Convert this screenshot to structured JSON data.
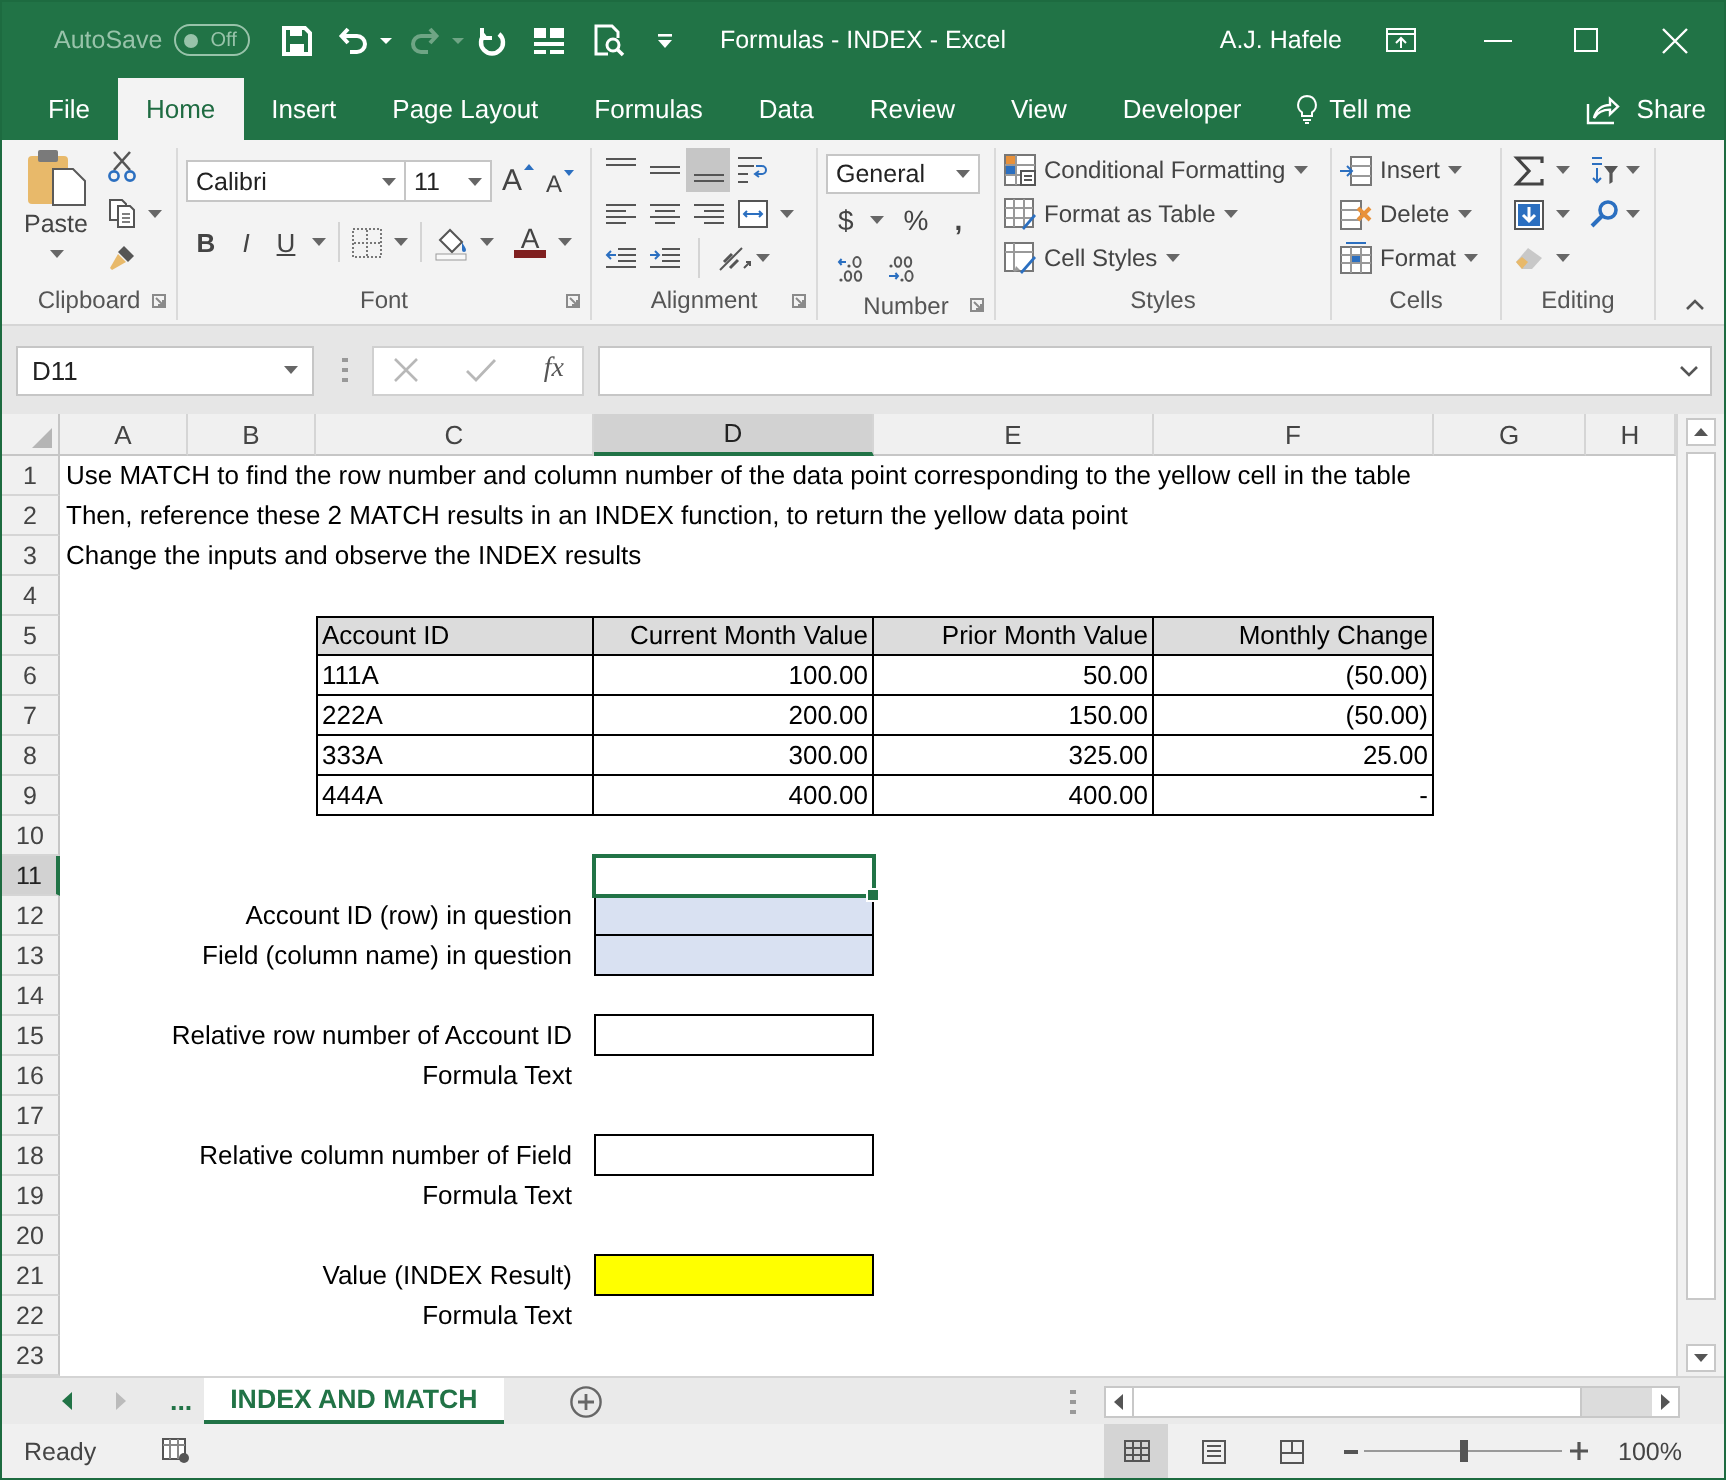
{
  "window": {
    "title": "Formulas - INDEX - Excel",
    "user": "A.J. Hafele"
  },
  "quick_access": {
    "autosave_label": "AutoSave",
    "autosave_state": "Off",
    "autosave_on": false,
    "tools": [
      {
        "kind": "save",
        "disabled": false
      },
      {
        "kind": "undo",
        "disabled": false
      },
      {
        "kind": "redo",
        "disabled": true
      },
      {
        "kind": "refresh",
        "disabled": false
      },
      {
        "kind": "layout",
        "disabled": false
      },
      {
        "kind": "preview",
        "disabled": false
      },
      {
        "kind": "customize",
        "disabled": false
      }
    ]
  },
  "ribbon_tabs": [
    {
      "label": "File",
      "selected": false
    },
    {
      "label": "Home",
      "selected": true
    },
    {
      "label": "Insert",
      "selected": false
    },
    {
      "label": "Page Layout",
      "selected": false
    },
    {
      "label": "Formulas",
      "selected": false
    },
    {
      "label": "Data",
      "selected": false
    },
    {
      "label": "Review",
      "selected": false
    },
    {
      "label": "View",
      "selected": false
    },
    {
      "label": "Developer",
      "selected": false
    }
  ],
  "tell_me": "Tell me",
  "share": "Share",
  "ribbon": {
    "clipboard": {
      "paste": "Paste",
      "label": "Clipboard"
    },
    "font": {
      "font_name": "Calibri",
      "font_size": "11",
      "grow": "A",
      "shrink": "A",
      "bold": "B",
      "italic": "I",
      "underline": "U",
      "font_color": "A",
      "label": "Font"
    },
    "alignment": {
      "vertical": [
        {
          "kind": "top",
          "selected": false
        },
        {
          "kind": "middle",
          "selected": false
        },
        {
          "kind": "bottom",
          "selected": true
        }
      ],
      "label": "Alignment"
    },
    "number": {
      "format": "General",
      "currency": "$",
      "percent": "%",
      "comma": ",",
      "label": "Number"
    },
    "styles": {
      "buttons": [
        {
          "kind": "conditional",
          "label": "Conditional Formatting"
        },
        {
          "kind": "table",
          "label": "Format as Table"
        },
        {
          "kind": "cell_styles",
          "label": "Cell Styles"
        }
      ],
      "label": "Styles"
    },
    "cells": {
      "buttons": [
        {
          "kind": "insert",
          "label": "Insert"
        },
        {
          "kind": "delete",
          "label": "Delete"
        },
        {
          "kind": "format",
          "label": "Format"
        }
      ],
      "label": "Cells"
    },
    "editing": {
      "label": "Editing"
    }
  },
  "formula_bar": {
    "name_box": "D11",
    "edit_buttons": [
      {
        "kind": "cancel",
        "disabled": true
      },
      {
        "kind": "enter",
        "disabled": true
      }
    ],
    "function_label": "fx"
  },
  "sheet": {
    "columns": [
      {
        "label": "A",
        "selected": false
      },
      {
        "label": "B",
        "selected": false
      },
      {
        "label": "C",
        "selected": false
      },
      {
        "label": "D",
        "selected": true
      },
      {
        "label": "E",
        "selected": false
      },
      {
        "label": "F",
        "selected": false
      },
      {
        "label": "G",
        "selected": false
      },
      {
        "label": "H",
        "selected": false
      }
    ],
    "rows": [
      {
        "number": "1",
        "selected": false,
        "kind": "note",
        "text": "Use MATCH to find the row number and column number of the data point corresponding to the yellow cell in the table"
      },
      {
        "number": "2",
        "selected": false,
        "kind": "note",
        "text": "Then, reference these 2 MATCH results in an INDEX function, to return the yellow data point"
      },
      {
        "number": "3",
        "selected": false,
        "kind": "note",
        "text": "Change the inputs and observe the INDEX results"
      },
      {
        "number": "4",
        "selected": false,
        "kind": "blank"
      },
      {
        "number": "5",
        "selected": false,
        "kind": "table_header",
        "cells": [
          "Account ID",
          "Current Month Value",
          "Prior Month Value",
          "Monthly Change"
        ]
      },
      {
        "number": "6",
        "selected": false,
        "kind": "table_row",
        "cells": [
          "111A",
          "100.00",
          "50.00",
          "(50.00)"
        ]
      },
      {
        "number": "7",
        "selected": false,
        "kind": "table_row",
        "cells": [
          "222A",
          "200.00",
          "150.00",
          "(50.00)"
        ]
      },
      {
        "number": "8",
        "selected": false,
        "kind": "table_row",
        "cells": [
          "333A",
          "300.00",
          "325.00",
          "25.00"
        ]
      },
      {
        "number": "9",
        "selected": false,
        "kind": "table_row",
        "cells": [
          "444A",
          "400.00",
          "400.00",
          "-"
        ]
      },
      {
        "number": "10",
        "selected": false,
        "kind": "blank"
      },
      {
        "number": "11",
        "selected": true,
        "kind": "input",
        "cell": {
          "color": "#ffffff",
          "bordered": false,
          "selected": true
        }
      },
      {
        "number": "12",
        "selected": false,
        "kind": "input",
        "label": "Account ID (row) in question",
        "cell": {
          "color": "#d9e1f2",
          "bordered": true,
          "selected": false
        }
      },
      {
        "number": "13",
        "selected": false,
        "kind": "input",
        "label": "Field (column name) in question",
        "cell": {
          "color": "#d9e1f2",
          "bordered": true,
          "selected": false
        }
      },
      {
        "number": "14",
        "selected": false,
        "kind": "blank"
      },
      {
        "number": "15",
        "selected": false,
        "kind": "input",
        "label": "Relative row number of Account ID",
        "cell": {
          "color": "#ffffff",
          "bordered": true,
          "selected": false
        }
      },
      {
        "number": "16",
        "selected": false,
        "kind": "label",
        "label": "Formula Text"
      },
      {
        "number": "17",
        "selected": false,
        "kind": "blank"
      },
      {
        "number": "18",
        "selected": false,
        "kind": "input",
        "label": "Relative column number of Field",
        "cell": {
          "color": "#ffffff",
          "bordered": true,
          "selected": false
        }
      },
      {
        "number": "19",
        "selected": false,
        "kind": "label",
        "label": "Formula Text"
      },
      {
        "number": "20",
        "selected": false,
        "kind": "blank"
      },
      {
        "number": "21",
        "selected": false,
        "kind": "input",
        "label": "Value (INDEX Result)",
        "cell": {
          "color": "#ffff00",
          "bordered": true,
          "selected": false
        }
      },
      {
        "number": "22",
        "selected": false,
        "kind": "label",
        "label": "Formula Text"
      },
      {
        "number": "23",
        "selected": false,
        "kind": "blank"
      }
    ]
  },
  "sheet_tabs": {
    "nav": [
      {
        "kind": "previous",
        "disabled": false
      },
      {
        "kind": "next",
        "disabled": true
      }
    ],
    "more": "...",
    "tabs": [
      {
        "label": "INDEX AND MATCH",
        "selected": true
      }
    ]
  },
  "status_bar": {
    "status": "Ready",
    "views": [
      {
        "kind": "normal",
        "selected": true
      },
      {
        "kind": "page_layout",
        "selected": false
      },
      {
        "kind": "page_break",
        "selected": false
      }
    ],
    "zoom_slider": {
      "level": 0.5
    },
    "zoom": "100%"
  }
}
